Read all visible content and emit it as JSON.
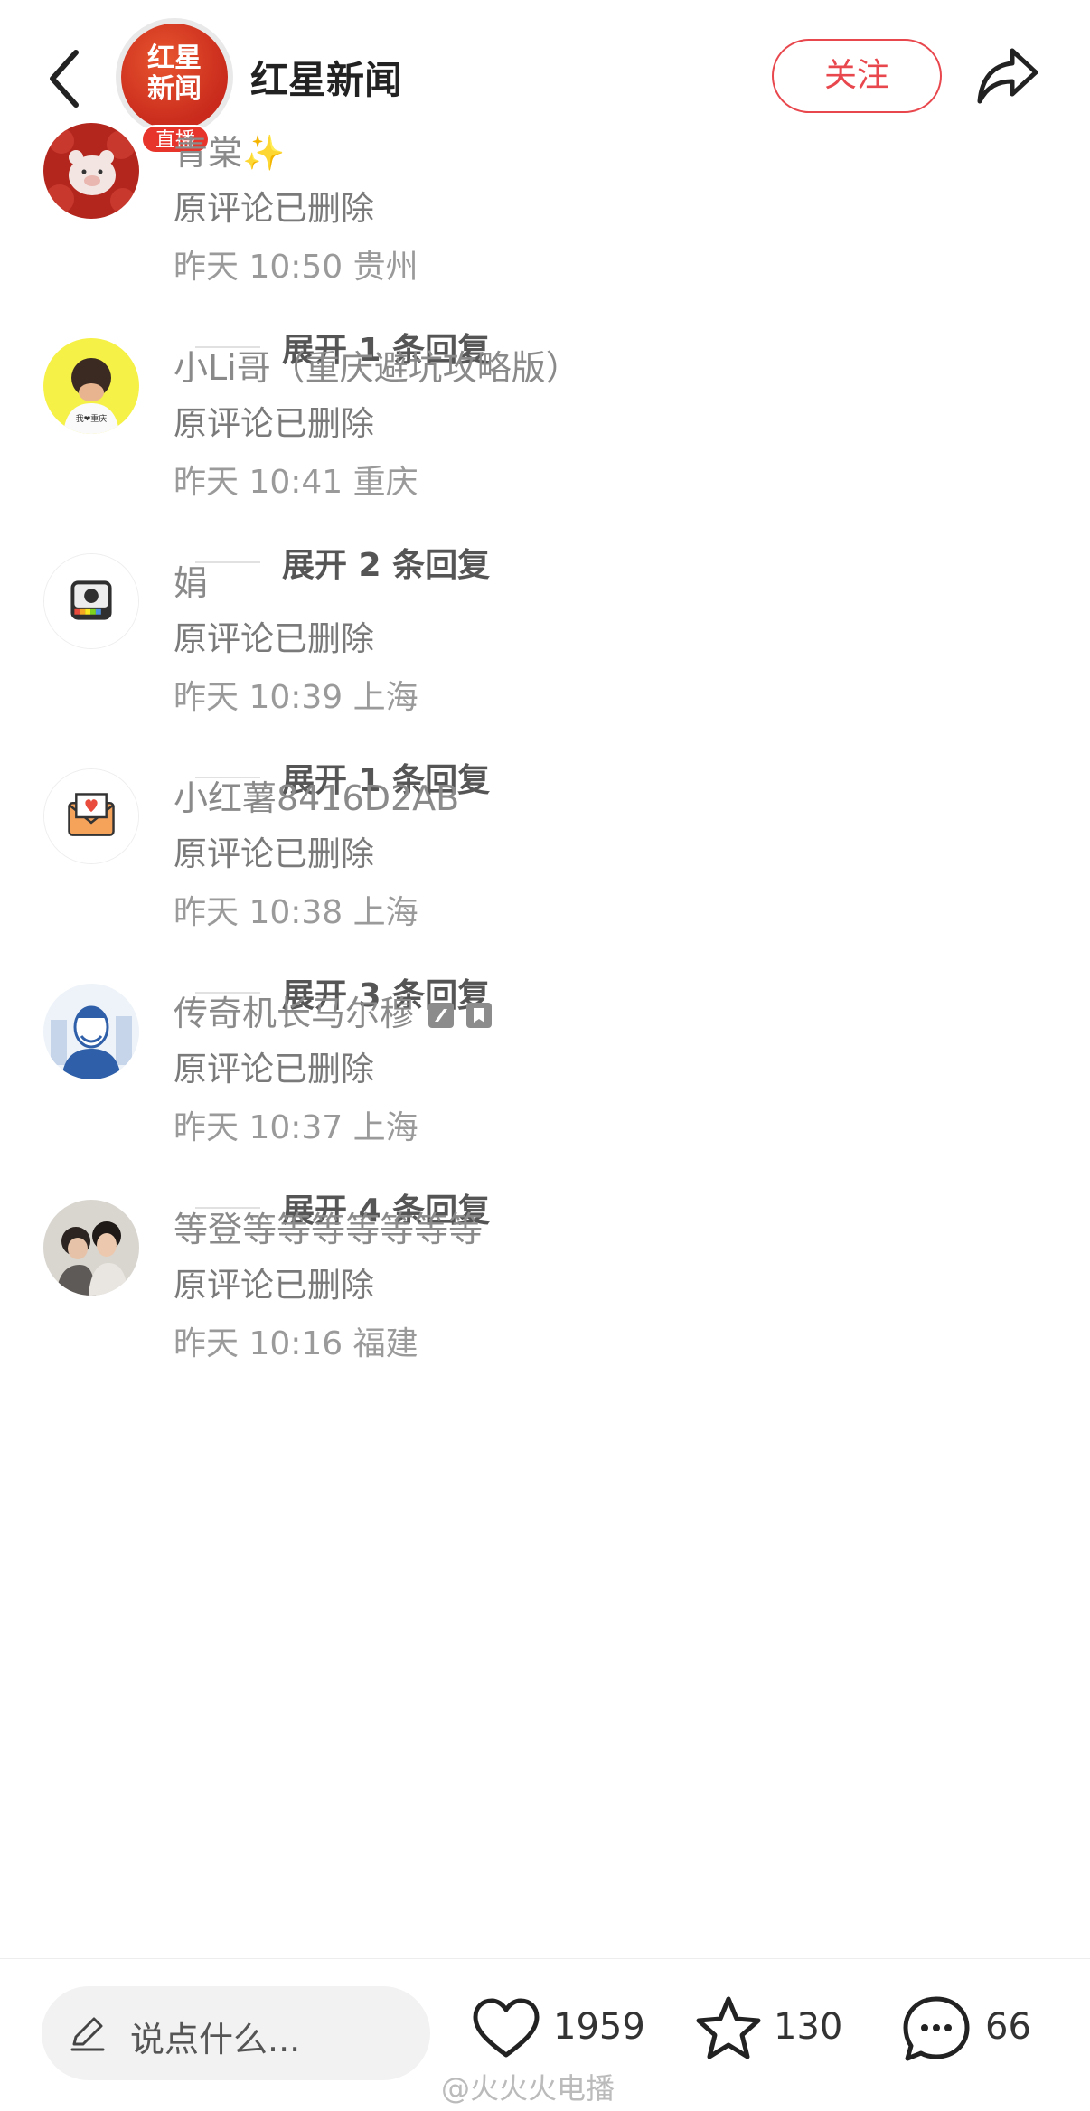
{
  "header": {
    "logo_text_1": "红星",
    "logo_text_2": "新闻",
    "live_badge": "直播",
    "account_name": "红星新闻",
    "follow_label": "关注"
  },
  "comments": [
    {
      "name": "青棠✨",
      "text": "原评论已删除",
      "meta": "昨天 10:50 贵州",
      "expand": "展开 1 条回复",
      "avatar": "pig-on-red-avatar"
    },
    {
      "name": "小Li哥（重庆避坑攻略版）",
      "text": "原评论已删除",
      "meta": "昨天 10:41 重庆",
      "expand": "展开 2 条回复",
      "avatar": "cartoon-boy-yellow-avatar",
      "avatar_caption": "我❤重庆"
    },
    {
      "name": "娟",
      "text": "原评论已删除",
      "meta": "昨天 10:39 上海",
      "expand": "展开 1 条回复",
      "avatar": "camera-avatar"
    },
    {
      "name": "小红薯8416D2AB",
      "text": "原评论已删除",
      "meta": "昨天 10:38 上海",
      "expand": "展开 3 条回复",
      "avatar": "envelope-heart-avatar"
    },
    {
      "name": "传奇机长马尔穆",
      "text": "原评论已删除",
      "meta": "昨天 10:37 上海",
      "expand": "展开 4 条回复",
      "avatar": "man-sketch-avatar"
    },
    {
      "name": "等登等等等等等等等",
      "text": "原评论已删除",
      "meta": "昨天 10:16 福建",
      "avatar": "two-people-photo-avatar"
    }
  ],
  "bottom": {
    "placeholder": "说点什么...",
    "likes": "1959",
    "stars": "130",
    "comments": "66",
    "watermark": "@火火火电播"
  },
  "colors": {
    "accent": "#e8474d",
    "brand_red": "#d2321f"
  }
}
